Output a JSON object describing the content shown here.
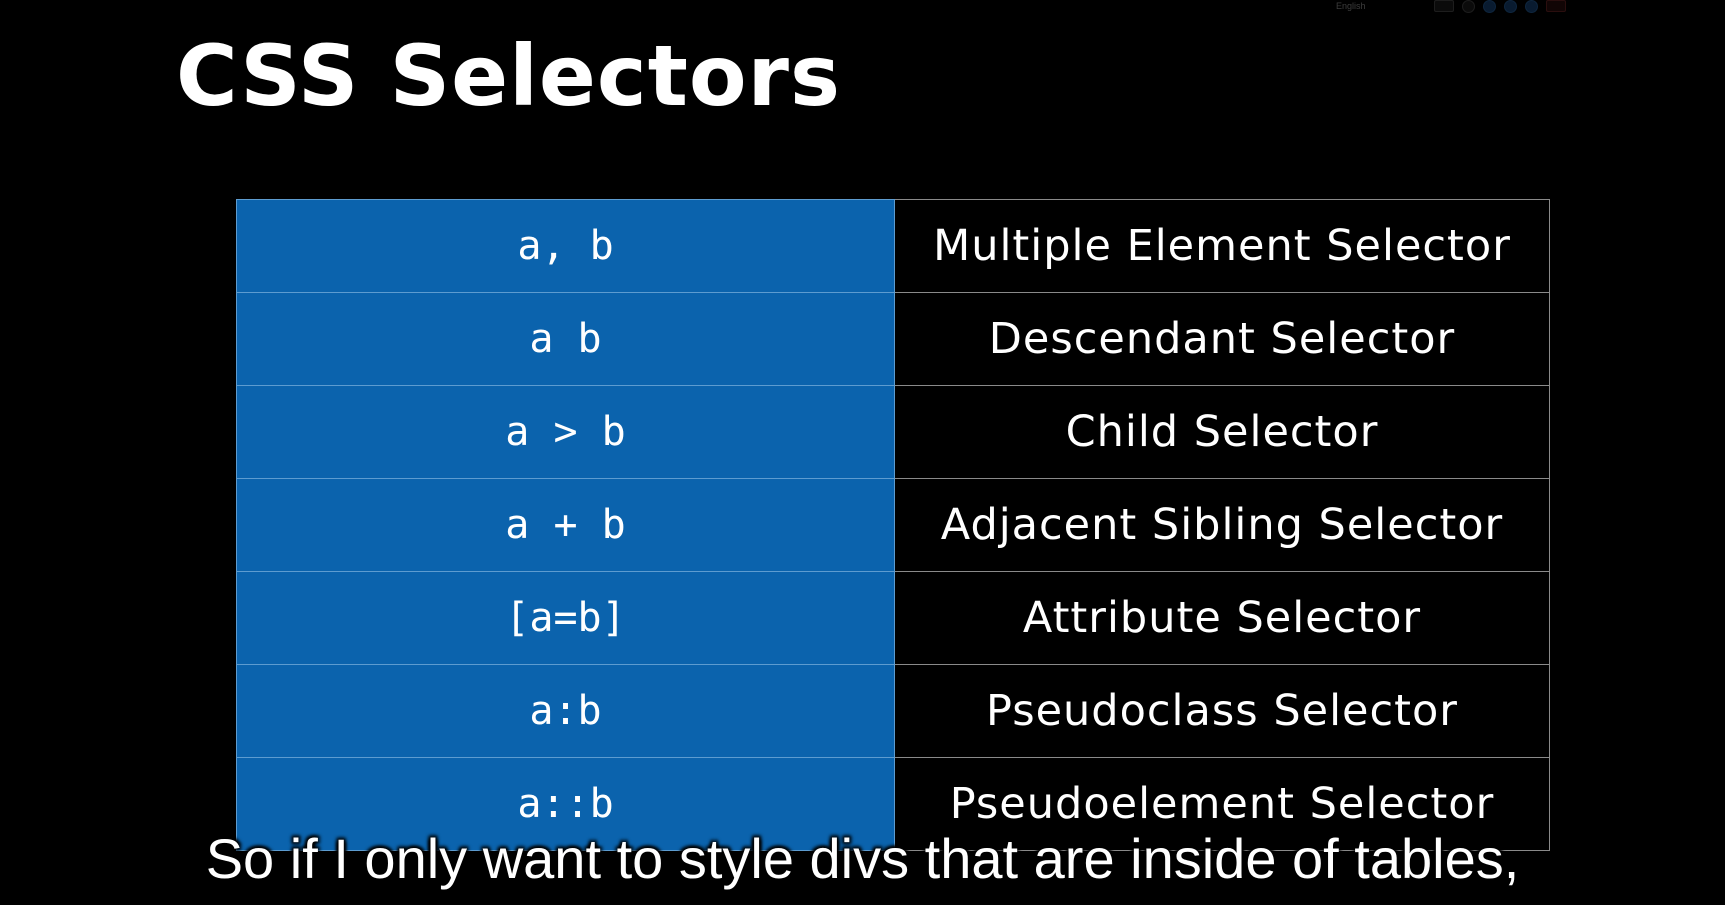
{
  "slide": {
    "title": "CSS Selectors"
  },
  "player_toolbar": {
    "language_label": "English"
  },
  "selectors_table": {
    "rows": [
      {
        "selector": "a, b",
        "description": "Multiple Element Selector"
      },
      {
        "selector": "a b",
        "description": "Descendant Selector"
      },
      {
        "selector": "a > b",
        "description": "Child Selector"
      },
      {
        "selector": "a + b",
        "description": "Adjacent Sibling Selector"
      },
      {
        "selector": "[a=b]",
        "description": "Attribute Selector"
      },
      {
        "selector": "a:b",
        "description": "Pseudoclass Selector"
      },
      {
        "selector": "a::b",
        "description": "Pseudoelement Selector"
      }
    ]
  },
  "subtitle": {
    "text": "So if I only want to style divs that are inside of tables,"
  },
  "colors": {
    "selector_cell_bg": "#0b63ad",
    "background": "#000000",
    "text": "#ffffff"
  }
}
